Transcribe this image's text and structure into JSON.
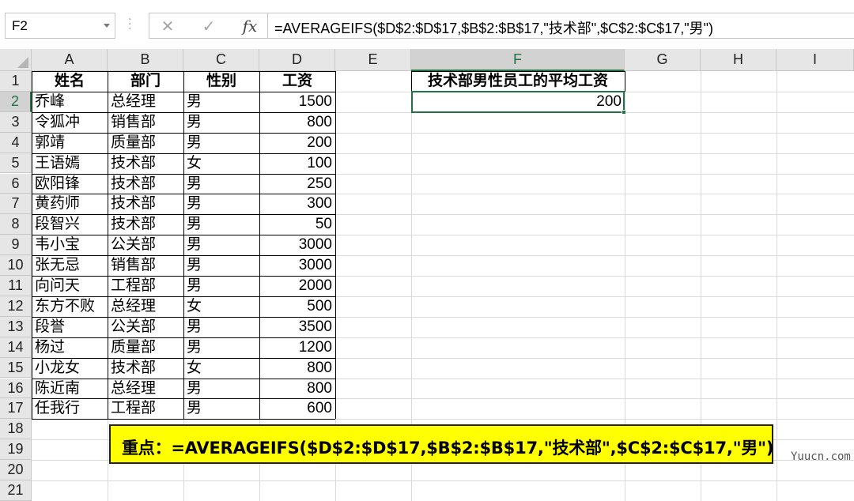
{
  "formula_bar": {
    "name_box": "F2",
    "cancel_icon": "✕",
    "enter_icon": "✓",
    "fx_label": "fx",
    "formula": "=AVERAGEIFS($D$2:$D$17,$B$2:$B$17,\"技术部\",$C$2:$C$17,\"男\")"
  },
  "columns": [
    "A",
    "B",
    "C",
    "D",
    "E",
    "F",
    "G",
    "H",
    "I"
  ],
  "rows": [
    "1",
    "2",
    "3",
    "4",
    "5",
    "6",
    "7",
    "8",
    "9",
    "10",
    "11",
    "12",
    "13",
    "14",
    "15",
    "16",
    "17",
    "18",
    "19",
    "20",
    "21"
  ],
  "table": {
    "headers": [
      "姓名",
      "部门",
      "性别",
      "工资"
    ],
    "rows": [
      [
        "乔峰",
        "总经理",
        "男",
        "1500"
      ],
      [
        "令狐冲",
        "销售部",
        "男",
        "800"
      ],
      [
        "郭靖",
        "质量部",
        "男",
        "200"
      ],
      [
        "王语嫣",
        "技术部",
        "女",
        "100"
      ],
      [
        "欧阳锋",
        "技术部",
        "男",
        "250"
      ],
      [
        "黄药师",
        "技术部",
        "男",
        "300"
      ],
      [
        "段智兴",
        "技术部",
        "男",
        "50"
      ],
      [
        "韦小宝",
        "公关部",
        "男",
        "3000"
      ],
      [
        "张无忌",
        "销售部",
        "男",
        "3000"
      ],
      [
        "向问天",
        "工程部",
        "男",
        "2000"
      ],
      [
        "东方不败",
        "总经理",
        "女",
        "500"
      ],
      [
        "段誉",
        "公关部",
        "男",
        "3500"
      ],
      [
        "杨过",
        "质量部",
        "男",
        "1200"
      ],
      [
        "小龙女",
        "技术部",
        "女",
        "800"
      ],
      [
        "陈近南",
        "总经理",
        "男",
        "800"
      ],
      [
        "任我行",
        "工程部",
        "男",
        "600"
      ]
    ]
  },
  "result": {
    "header": "技术部男性员工的平均工资",
    "value": "200"
  },
  "note": "重点：=AVERAGEIFS($D$2:$D$17,$B$2:$B$17,\"技术部\",$C$2:$C$17,\"男\")",
  "watermark": "Yuucn.com",
  "colors": {
    "accent": "#217346",
    "note_bg": "#ffff00",
    "header_bg": "#e6e6e6"
  }
}
